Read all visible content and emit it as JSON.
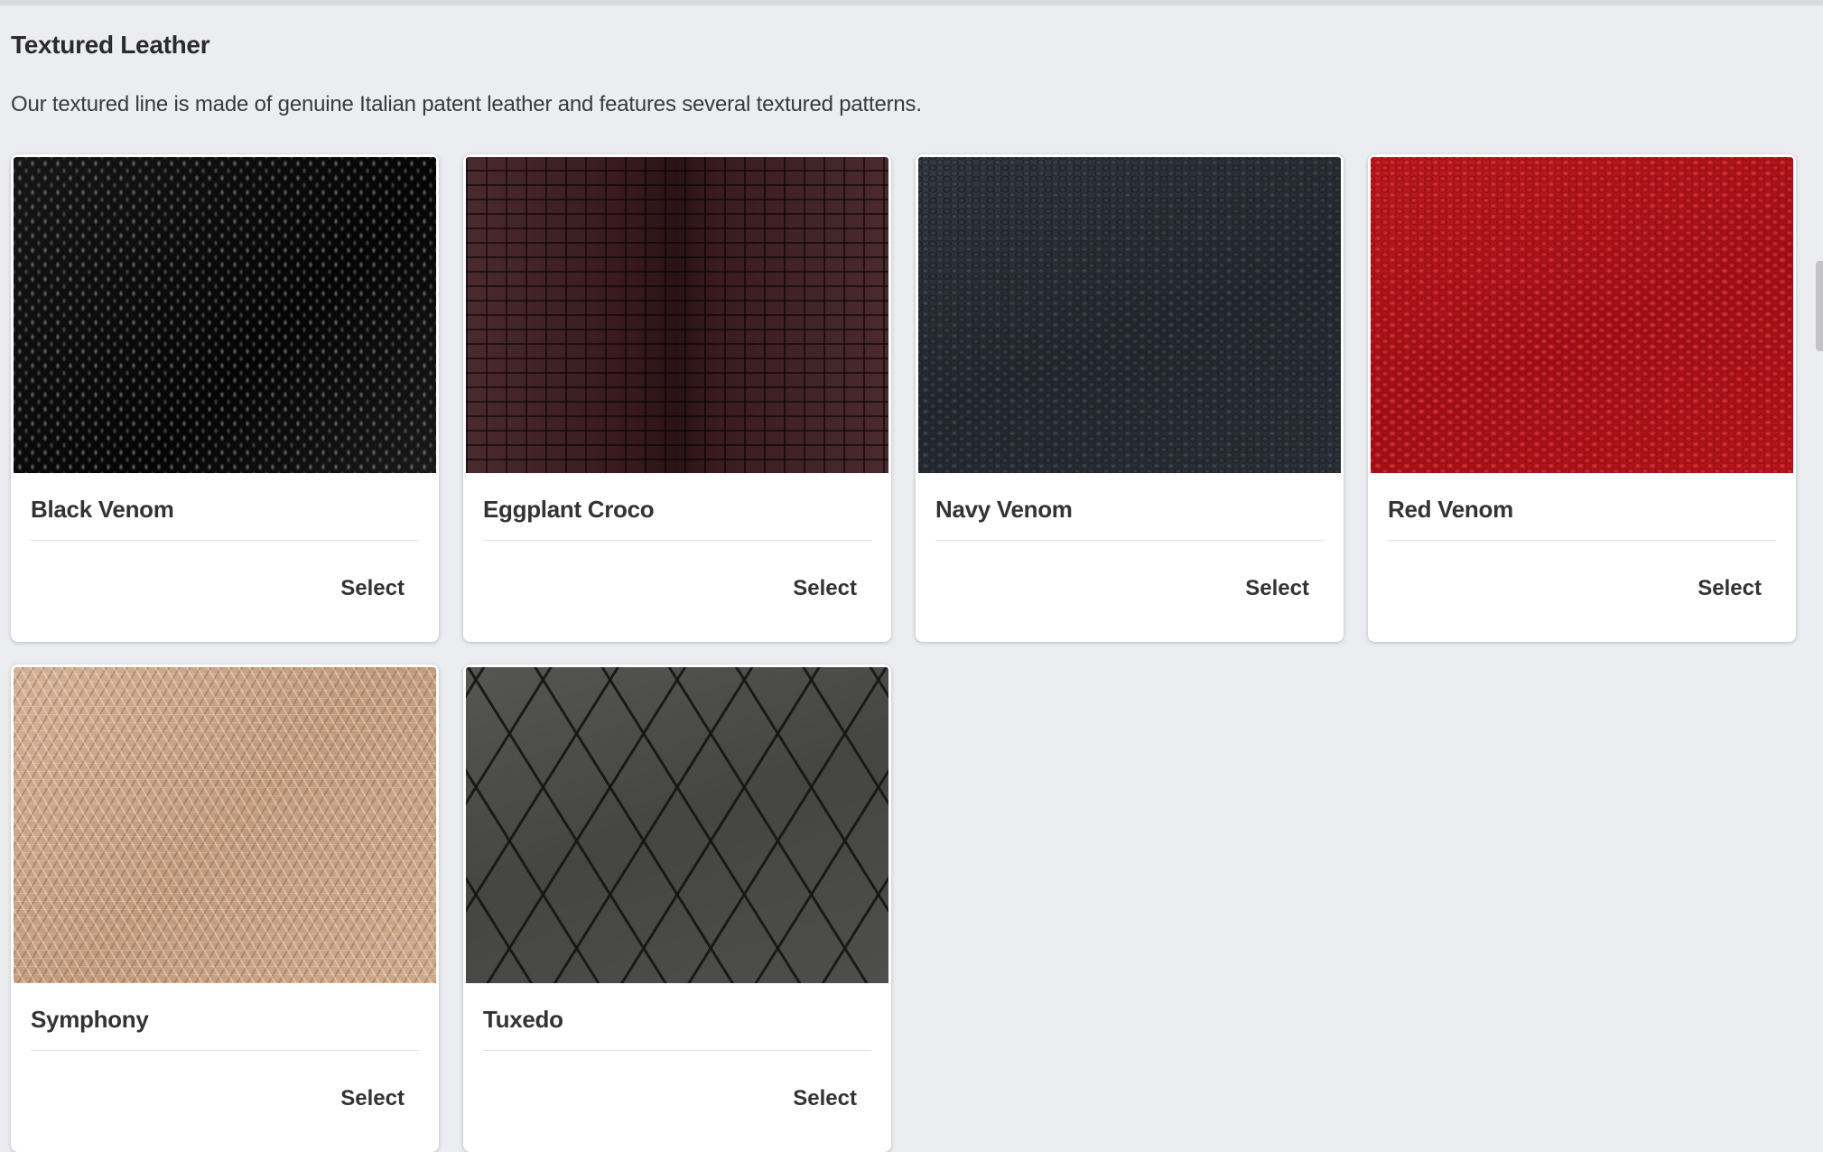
{
  "section": {
    "title": "Textured Leather",
    "description": "Our textured line is made of genuine Italian patent leather and features several textured patterns."
  },
  "products": [
    {
      "name": "Black Venom",
      "action_label": "Select",
      "texture": "black-snakeskin",
      "color": "#0c0c0c"
    },
    {
      "name": "Eggplant Croco",
      "action_label": "Select",
      "texture": "eggplant-crocodile",
      "color": "#3b1e22"
    },
    {
      "name": "Navy Venom",
      "action_label": "Select",
      "texture": "navy-snakeskin",
      "color": "#2a3038"
    },
    {
      "name": "Red Venom",
      "action_label": "Select",
      "texture": "red-snakeskin",
      "color": "#b0141c"
    },
    {
      "name": "Symphony",
      "action_label": "Select",
      "texture": "tan-woven",
      "color": "#c9a487"
    },
    {
      "name": "Tuxedo",
      "action_label": "Select",
      "texture": "gray-quilted-diamond",
      "color": "#4a4a48"
    }
  ],
  "colors": {
    "page_background": "#ecedf0",
    "card_background": "#ffffff",
    "text": "#333333"
  }
}
